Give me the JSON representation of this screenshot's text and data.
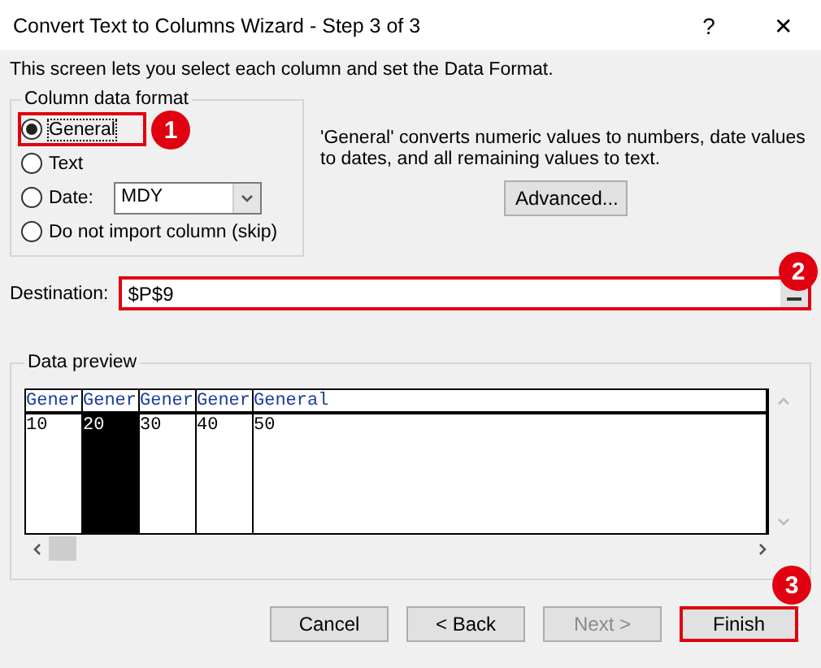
{
  "window": {
    "title": "Convert Text to Columns Wizard - Step 3 of 3",
    "buttons": [
      "?",
      "✕"
    ]
  },
  "intro": "This screen lets you select each column and set the Data Format.",
  "format_group": {
    "legend": "Column data format",
    "options": [
      {
        "label": "General",
        "selected": true,
        "kind": "plain",
        "callout": "1"
      },
      {
        "label": "Text",
        "selected": false,
        "kind": "plain"
      },
      {
        "label": "Date:",
        "selected": false,
        "kind": "date",
        "value": "MDY"
      },
      {
        "label": "Do not import column (skip)",
        "selected": false,
        "kind": "plain"
      }
    ]
  },
  "description": "'General' converts numeric values to numbers, date values to dates, and all remaining values to text.",
  "advanced_button": "Advanced...",
  "destination": {
    "label": "Destination:",
    "value": "$P$9",
    "callout": "2"
  },
  "preview": {
    "legend": "Data preview",
    "columns": [
      {
        "header": "Gener",
        "value": "10",
        "selected": false
      },
      {
        "header": "Gener",
        "value": "20",
        "selected": true
      },
      {
        "header": "Gener",
        "value": "30",
        "selected": false
      },
      {
        "header": "Gener",
        "value": "40",
        "selected": false
      },
      {
        "header": "General",
        "value": "50",
        "selected": false
      }
    ]
  },
  "buttons": [
    {
      "label": "Cancel",
      "disabled": false
    },
    {
      "label": "< Back",
      "disabled": false
    },
    {
      "label": "Next >",
      "disabled": true
    },
    {
      "label": "Finish",
      "disabled": false,
      "callout": "3"
    }
  ]
}
